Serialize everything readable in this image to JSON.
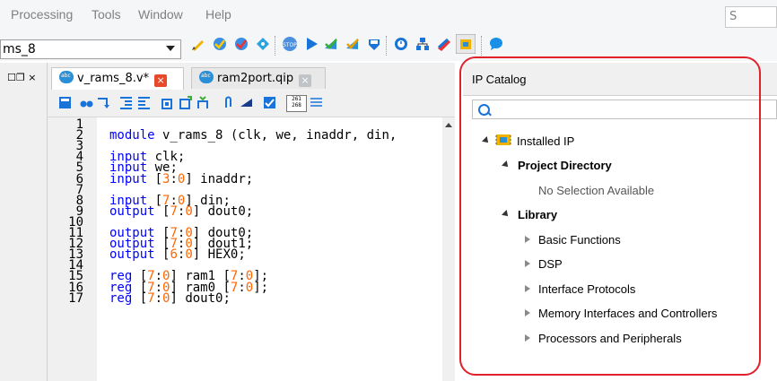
{
  "menu": {
    "items": [
      "Processing",
      "Tools",
      "Window",
      "Help"
    ],
    "search_placeholder": "S"
  },
  "toolbar": {
    "revision": "ms_8"
  },
  "left_panel": {
    "controls": "☐❐ ×"
  },
  "editor": {
    "tabs": [
      {
        "label": "v_rams_8.v*",
        "active": true
      },
      {
        "label": "ram2port.qip",
        "active": false
      }
    ],
    "line_numbers": [
      "1",
      "2",
      "3",
      "4",
      "5",
      "6",
      "7",
      "8",
      "9",
      "10",
      "11",
      "12",
      "13",
      "14",
      "15",
      "16",
      "17"
    ],
    "code_lines": [
      "",
      "module v_rams_8 (clk, we, inaddr, din,",
      "",
      "input clk;",
      "input we;",
      "input [3:0] inaddr;",
      "",
      "input [7:0] din;",
      "output [7:0] dout0;",
      "",
      "output [7:0] dout0;",
      "output [7:0] dout1;",
      "output [6:0] HEX0;",
      "",
      "reg [7:0] ram1 [7:0];",
      "reg [7:0] ram0 [7:0];",
      "reg [7:0] dout0;"
    ],
    "tool_counter": "261 268"
  },
  "ip_catalog": {
    "title": "IP Catalog",
    "search_value": "",
    "installed": "Installed IP",
    "project_directory": "Project Directory",
    "no_selection": "No Selection Available",
    "library": "Library",
    "library_items": [
      "Basic Functions",
      "DSP",
      "Interface Protocols",
      "Memory Interfaces and Controllers",
      "Processors and Peripherals"
    ]
  },
  "colors": {
    "keyword": "#0000ff",
    "number": "#ff6600",
    "highlight": "#e0202a",
    "tab_close": "#e64a2b"
  }
}
